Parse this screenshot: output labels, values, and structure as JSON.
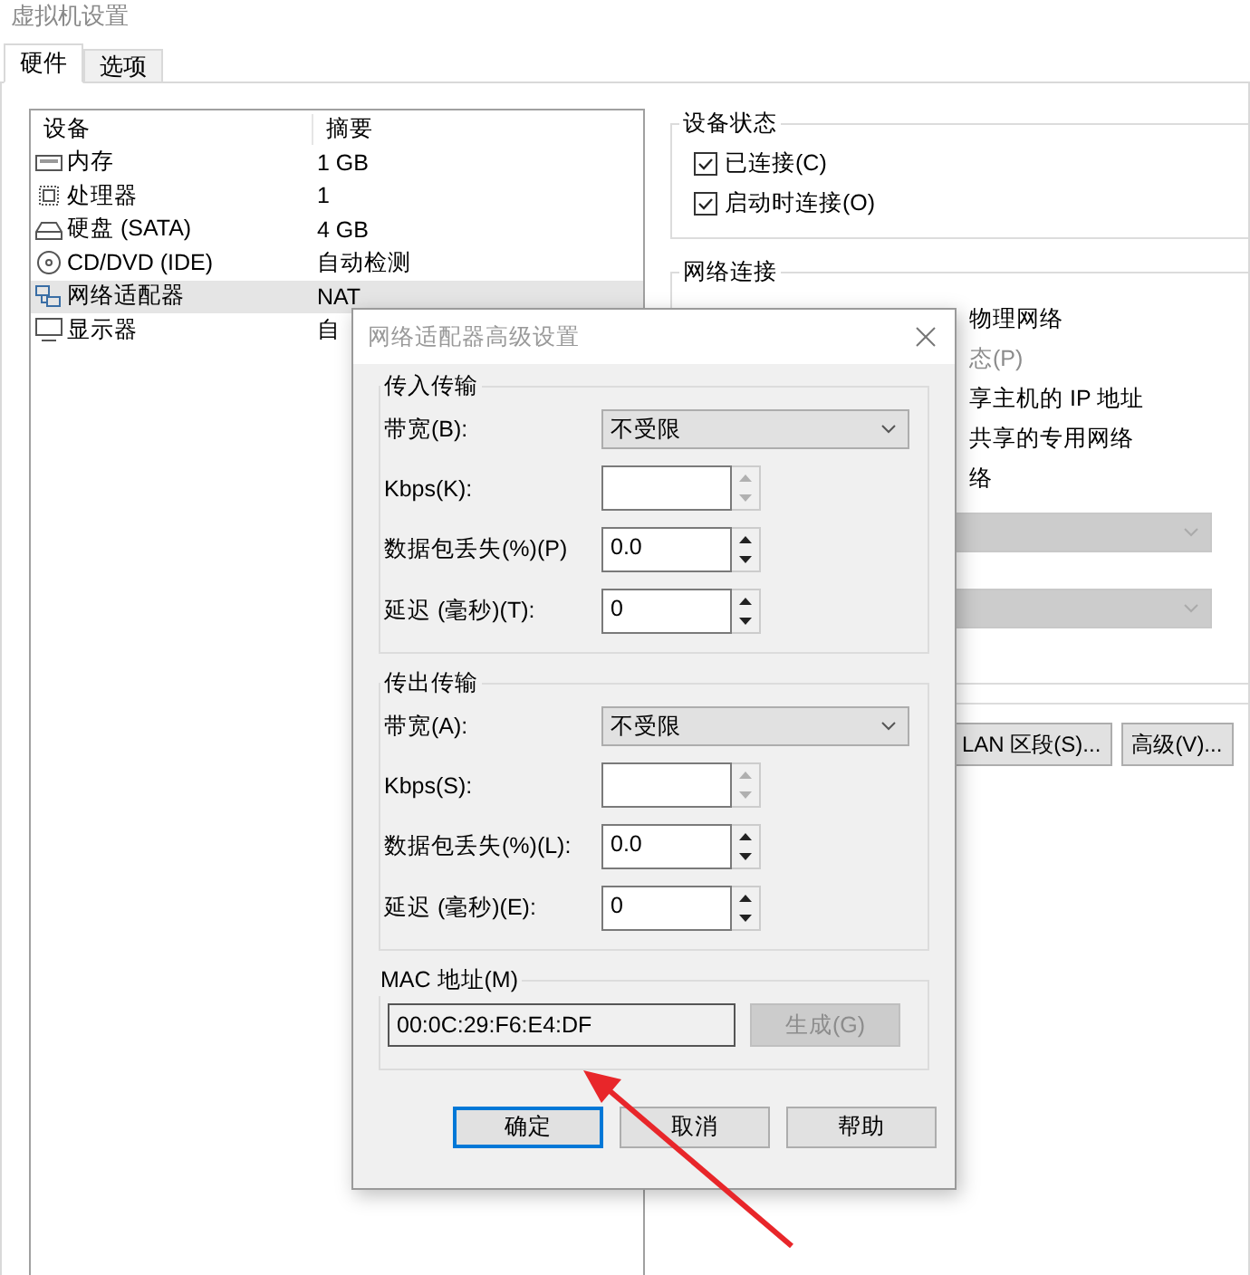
{
  "window": {
    "title": "虚拟机设置"
  },
  "tabs": [
    {
      "label": "硬件",
      "selected": true
    },
    {
      "label": "选项",
      "selected": false
    }
  ],
  "devices": {
    "columns": [
      "设备",
      "摘要"
    ],
    "rows": [
      {
        "kind": "memory",
        "name": "内存",
        "summary": "1 GB",
        "selected": false
      },
      {
        "kind": "cpu",
        "name": "处理器",
        "summary": "1",
        "selected": false
      },
      {
        "kind": "disk",
        "name": "硬盘 (SATA)",
        "summary": "4 GB",
        "selected": false
      },
      {
        "kind": "cd",
        "name": "CD/DVD (IDE)",
        "summary": "自动检测",
        "selected": false
      },
      {
        "kind": "network",
        "name": "网络适配器",
        "summary": "NAT",
        "selected": true
      },
      {
        "kind": "display",
        "name": "显示器",
        "summary": "自",
        "selected": false
      }
    ]
  },
  "device_status": {
    "title": "设备状态",
    "options": [
      {
        "label": "已连接(C)",
        "checked": true
      },
      {
        "label": "启动时连接(O)",
        "checked": true
      }
    ]
  },
  "network_connection": {
    "title": "网络连接",
    "texts": [
      {
        "text": "物理网络",
        "disabled": false
      },
      {
        "text": "态(P)",
        "disabled": true
      },
      {
        "text": "享主机的 IP 地址",
        "disabled": false
      },
      {
        "text": "共享的专用网络",
        "disabled": false
      },
      {
        "text": "络",
        "disabled": false
      }
    ],
    "dropdowns": [
      {
        "disabled": true
      },
      {
        "disabled": true
      }
    ],
    "buttons": [
      "LAN 区段(S)...",
      "高级(V)..."
    ]
  },
  "dialog": {
    "title": "网络适配器高级设置",
    "groups": [
      {
        "title": "传入传输",
        "fields": [
          {
            "kind": "select",
            "label": "带宽(B):",
            "value": "不受限"
          },
          {
            "kind": "spin",
            "label": "Kbps(K):",
            "disabled": true
          },
          {
            "kind": "spin",
            "label": "数据包丢失(%)(P)",
            "value": "0.0",
            "disabled": false
          },
          {
            "kind": "spin",
            "label": "延迟 (毫秒)(T):",
            "value": "0",
            "disabled": false
          }
        ]
      },
      {
        "title": "传出传输",
        "fields": [
          {
            "kind": "select",
            "label": "带宽(A):",
            "value": "不受限"
          },
          {
            "kind": "spin",
            "label": "Kbps(S):",
            "disabled": true
          },
          {
            "kind": "spin",
            "label": "数据包丢失(%)(L):",
            "value": "0.0",
            "disabled": false
          },
          {
            "kind": "spin",
            "label": "延迟 (毫秒)(E):",
            "value": "0",
            "disabled": false
          }
        ]
      }
    ],
    "mac": {
      "title": "MAC 地址(M)",
      "value": "00:0C:29:F6:E4:DF",
      "button": {
        "label": "生成(G)",
        "disabled": true
      }
    },
    "buttons": [
      {
        "label": "确定",
        "default": true
      },
      {
        "label": "取消",
        "default": false
      },
      {
        "label": "帮助",
        "default": false
      }
    ]
  }
}
